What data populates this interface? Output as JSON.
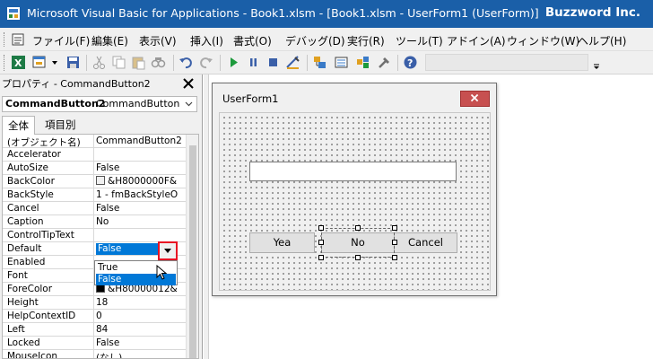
{
  "window": {
    "title": "Microsoft Visual Basic for Applications - Book1.xlsm - [Book1.xlsm - UserForm1 (UserForm)]",
    "brand": "Buzzword Inc."
  },
  "menu": {
    "items": [
      "ファイル(F)",
      "編集(E)",
      "表示(V)",
      "挿入(I)",
      "書式(O)",
      "デバッグ(D)",
      "実行(R)",
      "ツール(T)",
      "アドイン(A)",
      "ウィンドウ(W)",
      "ヘルプ(H)"
    ]
  },
  "toolbar": {
    "icons": [
      "excel-icon",
      "insert-userform-icon",
      "save-icon",
      "cut-icon",
      "copy-icon",
      "paste-icon",
      "find-icon",
      "undo-icon",
      "redo-icon",
      "run-icon",
      "break-icon",
      "reset-icon",
      "design-mode-icon",
      "project-explorer-icon",
      "properties-icon",
      "object-browser-icon",
      "toolbox-icon",
      "help-icon"
    ]
  },
  "properties": {
    "title": "プロパティ - CommandButton2",
    "object_name": "CommandButton2",
    "object_type": "CommandButton",
    "tabs": [
      "全体",
      "項目別"
    ],
    "rows": [
      {
        "name": "(オブジェクト名)",
        "value": "CommandButton2"
      },
      {
        "name": "Accelerator",
        "value": ""
      },
      {
        "name": "AutoSize",
        "value": "False"
      },
      {
        "name": "BackColor",
        "value": "&H8000000F&",
        "swatch": "#f0f0f0"
      },
      {
        "name": "BackStyle",
        "value": "1 - fmBackStyleO"
      },
      {
        "name": "Cancel",
        "value": "False"
      },
      {
        "name": "Caption",
        "value": "No"
      },
      {
        "name": "ControlTipText",
        "value": ""
      },
      {
        "name": "Default",
        "value": ""
      },
      {
        "name": "Enabled",
        "value": ""
      },
      {
        "name": "Font",
        "value": ""
      },
      {
        "name": "ForeColor",
        "value": "&H80000012&",
        "swatch": "#000000"
      },
      {
        "name": "Height",
        "value": "18"
      },
      {
        "name": "HelpContextID",
        "value": "0"
      },
      {
        "name": "Left",
        "value": "84"
      },
      {
        "name": "Locked",
        "value": "False"
      },
      {
        "name": "MouseIcon",
        "value": "(なし)"
      }
    ],
    "default_value": "False",
    "dropdown_options": [
      "True",
      "False"
    ],
    "selected_option": "False",
    "accent": "#0078d7",
    "highlight_border": "#e81123"
  },
  "userform": {
    "title": "UserForm1",
    "buttons": [
      "Yea",
      "No",
      "Cancel"
    ],
    "selected_button": "No"
  }
}
